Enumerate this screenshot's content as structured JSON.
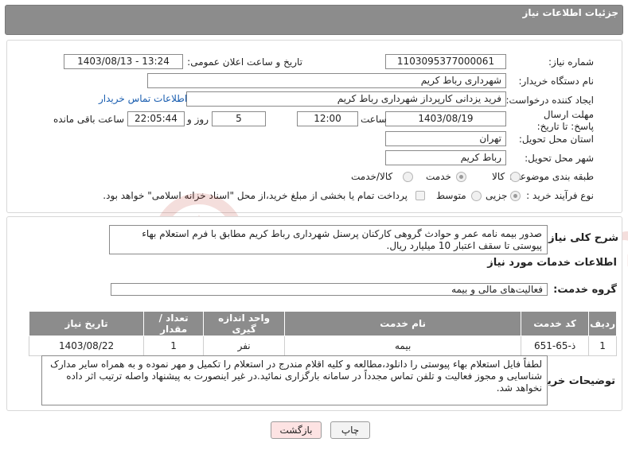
{
  "header": {
    "title": "جزئیات اطلاعات نیاز"
  },
  "fields": {
    "need_number_label": "شماره نیاز:",
    "need_number": "1103095377000061",
    "announce_label": "تاریخ و ساعت اعلان عمومی:",
    "announce_value": "1403/08/13 - 13:24",
    "buyer_org_label": "نام دستگاه خریدار:",
    "buyer_org": "شهرداری رباط کریم",
    "creator_label": "ایجاد کننده درخواست:",
    "creator": "فرید یزدانی کارپرداز شهرداری رباط کریم",
    "contact_link": "اطلاعات تماس خریدار",
    "deadline_label": "مهلت ارسال پاسخ: تا تاریخ:",
    "deadline_date": "1403/08/19",
    "time_label": "ساعت",
    "deadline_time": "12:00",
    "days_count": "5",
    "days_label": "روز و",
    "remaining_time": "22:05:44",
    "remaining_label": "ساعت باقی مانده",
    "province_label": "استان محل تحویل:",
    "province": "تهران",
    "city_label": "شهر محل تحویل:",
    "city": "رباط کریم",
    "category_label": "طبقه بندی موضوعی:",
    "category_options": [
      "کالا",
      "خدمت",
      "کالا/خدمت"
    ],
    "category_selected": "خدمت",
    "process_label": "نوع فرآیند خرید :",
    "process_options": [
      "جزیی",
      "متوسط"
    ],
    "process_selected": "جزیی",
    "treasury_note": "پرداخت تمام یا بخشی از مبلغ خرید،از محل \"اسناد خزانه اسلامی\" خواهد بود."
  },
  "summary": {
    "label": "شرح کلی نیاز:",
    "text": "صدور بیمه نامه عمر و حوادث گروهی کارکنان پرسنل شهرداری رباط کریم مطابق با فرم استعلام بهاء پیوستی تا سقف اعتبار 10 میلیارد ریال."
  },
  "services": {
    "section_title": "اطلاعات خدمات مورد نیاز",
    "group_label": "گروه خدمت:",
    "group_value": "فعالیت‌های مالی و بیمه",
    "columns": [
      "ردیف",
      "کد خدمت",
      "نام خدمت",
      "واحد اندازه گیری",
      "تعداد / مقدار",
      "تاریخ نیاز"
    ],
    "rows": [
      [
        "1",
        "ذ-65-651",
        "بیمه",
        "نفر",
        "1",
        "1403/08/22"
      ]
    ]
  },
  "buyer_notes": {
    "label": "توضیحات خریدار:",
    "text": "لطفاً فایل استعلام بهاء پیوستی را دانلود،مطالعه و کلیه اقلام مندرج در استعلام را تکمیل و مهر نموده و به همراه سایر مدارک شناسایی و مجوز فعالیت و تلفن تماس مجدداً در سامانه بارگزاری نمائید.در غیر اینصورت به پیشنهاد واصله ترتیب اثر داده نخواهد شد."
  },
  "buttons": {
    "print": "چاپ",
    "back": "بازگشت"
  },
  "colors": {
    "header_bg": "#8c8c8c",
    "link": "#1a5eb0",
    "back_btn_bg": "#fde3e3",
    "watermark": "#c0392b"
  },
  "watermark": {
    "text": "AriaTender.neT"
  }
}
